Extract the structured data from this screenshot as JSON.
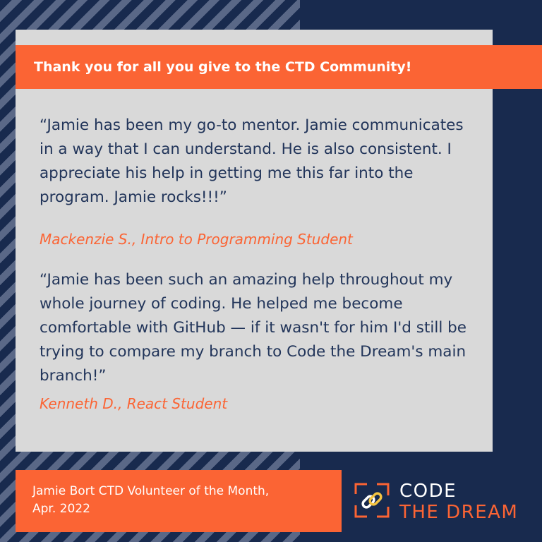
{
  "banner": {
    "text": "Thank you for all you give to the CTD Community!"
  },
  "testimonials": [
    {
      "quote": "“Jamie has been my go-to mentor. Jamie communicates in a way that I can understand. He is also consistent. I appreciate his help in getting me this far into the program. Jamie rocks!!!”",
      "author": "Mackenzie S., Intro to Programming Student"
    },
    {
      "quote": "“Jamie has been such an amazing help throughout my whole journey of coding. He helped me become comfortable with GitHub — if it wasn't for him I'd still be trying to compare my branch to Code the Dream's main branch!”",
      "author": "Kenneth D., React Student"
    }
  ],
  "footer": {
    "line1": "Jamie Bort CTD Volunteer of the Month,",
    "line2": "Apr. 2022"
  },
  "logo": {
    "line1": "CODE",
    "line2": "THE DREAM",
    "icon": "chain-link-icon"
  },
  "colors": {
    "navy": "#182a4e",
    "orange": "#fb6434",
    "card": "#d9d9d9",
    "text": "#22355a"
  }
}
